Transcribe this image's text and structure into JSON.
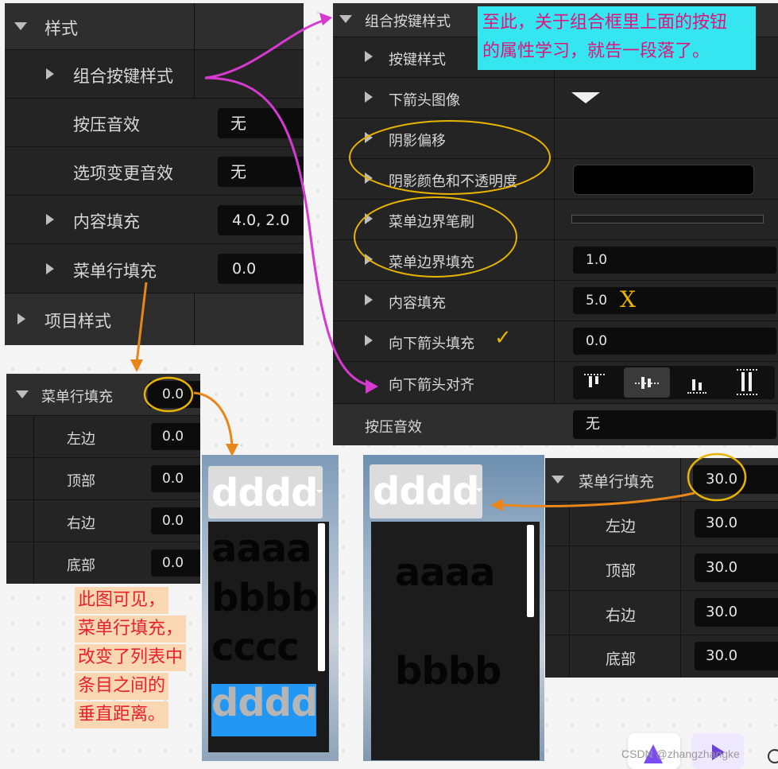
{
  "panel1": {
    "style_header": "样式",
    "combo_style": "组合按键样式",
    "press_sound": "按压音效",
    "press_sound_value": "无",
    "option_change_sound": "选项变更音效",
    "option_change_value": "无",
    "content_padding": "内容填充",
    "content_padding_value": "4.0, 2.0",
    "menu_row_padding": "菜单行填充",
    "menu_row_padding_value": "0.0",
    "item_style": "项目样式"
  },
  "panel2": {
    "header": "组合按键样式",
    "button_style": "按键样式",
    "down_arrow_image": "下箭头图像",
    "shadow_offset": "阴影偏移",
    "shadow_color": "阴影颜色和不透明度",
    "menu_border_brush": "菜单边界笔刷",
    "menu_border_padding": "菜单边界填充",
    "menu_border_padding_value": "1.0",
    "content_padding": "内容填充",
    "content_padding_value": "5.0",
    "down_arrow_padding": "向下箭头填充",
    "down_arrow_padding_value": "0.0",
    "down_arrow_align": "向下箭头对齐",
    "press_sound": "按压音效",
    "press_sound_value": "无"
  },
  "note_top": {
    "line1": "至此，关于组合框里上面的按钮",
    "line2": "的属性学习，就告一段落了。"
  },
  "panel3": {
    "header": "菜单行填充",
    "header_value": "0.0",
    "rows": [
      {
        "label": "左边",
        "value": "0.0"
      },
      {
        "label": "顶部",
        "value": "0.0"
      },
      {
        "label": "右边",
        "value": "0.0"
      },
      {
        "label": "底部",
        "value": "0.0"
      }
    ]
  },
  "panel4": {
    "header": "菜单行填充",
    "header_value": "30.0",
    "rows": [
      {
        "label": "左边",
        "value": "30.0"
      },
      {
        "label": "顶部",
        "value": "30.0"
      },
      {
        "label": "右边",
        "value": "30.0"
      },
      {
        "label": "底部",
        "value": "30.0"
      }
    ]
  },
  "note_left": {
    "line1": "此图可见，",
    "line2": "菜单行填充，",
    "line3": "改变了列表中",
    "line4": "条目之间的",
    "line5": "垂直距离。"
  },
  "preview_small": {
    "selected": "dddd",
    "items": [
      "aaaa",
      "bbbb",
      "cccc",
      "dddd"
    ]
  },
  "preview_large": {
    "selected": "dddd",
    "items": [
      "aaaa",
      "bbbb"
    ]
  },
  "x_mark": "X",
  "check_mark": "✓",
  "watermark": "CSDN @zhangzhangke",
  "colors": {
    "magenta_arrow": "#d63ad0",
    "orange_arrow": "#e8861a",
    "yellow_circle": "#e8b400",
    "cyan_note_bg": "#35e5ef",
    "magenta_note_text": "#e0147a",
    "pink_note_bg": "#f9d7b2",
    "red_note_text": "#e8202a",
    "selected_item_bg": "#2196f3"
  }
}
